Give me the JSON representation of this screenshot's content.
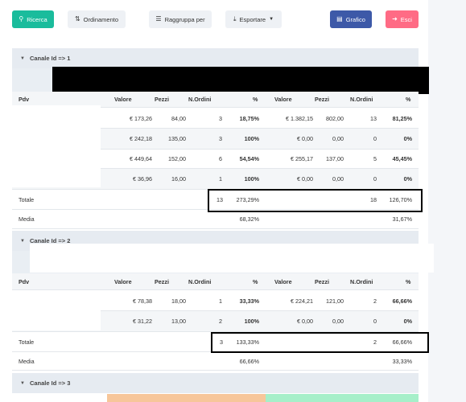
{
  "toolbar": {
    "search": "Ricerca",
    "sort": "Ordinamento",
    "group": "Raggruppa per",
    "export": "Esportare",
    "chart": "Grafico",
    "exit": "Esci"
  },
  "headers": [
    "Pdv",
    "Valore",
    "Pezzi",
    "N.Ordini",
    "%",
    "Valore",
    "Pezzi",
    "N.Ordini",
    "%"
  ],
  "groups": [
    {
      "title": "Canale Id => 1",
      "rows": [
        [
          "",
          "€ 173,26",
          "84,00",
          "3",
          "18,75%",
          "€ 1.382,15",
          "802,00",
          "13",
          "81,25%"
        ],
        [
          "",
          "€ 242,18",
          "135,00",
          "3",
          "100%",
          "€ 0,00",
          "0,00",
          "0",
          "0%"
        ],
        [
          "",
          "€ 449,64",
          "152,00",
          "6",
          "54,54%",
          "€ 255,17",
          "137,00",
          "5",
          "45,45%"
        ],
        [
          "",
          "€ 36,96",
          "16,00",
          "1",
          "100%",
          "€ 0,00",
          "0,00",
          "0",
          "0%"
        ]
      ],
      "totale": {
        "label": "Totale",
        "ordini1": "13",
        "pct1": "273,29%",
        "ordini2": "18",
        "pct2": "126,70%"
      },
      "media": {
        "label": "Media",
        "pct1": "68,32%",
        "pct2": "31,67%"
      }
    },
    {
      "title": "Canale Id => 2",
      "rows": [
        [
          "",
          "€ 78,38",
          "18,00",
          "1",
          "33,33%",
          "€ 224,21",
          "121,00",
          "2",
          "66,66%"
        ],
        [
          "",
          "€ 31,22",
          "13,00",
          "2",
          "100%",
          "€ 0,00",
          "0,00",
          "0",
          "0%"
        ]
      ],
      "totale": {
        "label": "Totale",
        "ordini1": "3",
        "pct1": "133,33%",
        "ordini2": "2",
        "pct2": "66,66%"
      },
      "media": {
        "label": "Media",
        "pct1": "66,66%",
        "pct2": "33,33%"
      }
    },
    {
      "title": "Canale Id => 3"
    }
  ],
  "colors": {
    "green": "#1abc9c",
    "blue": "#3d59a8",
    "red": "#ff6b85"
  }
}
